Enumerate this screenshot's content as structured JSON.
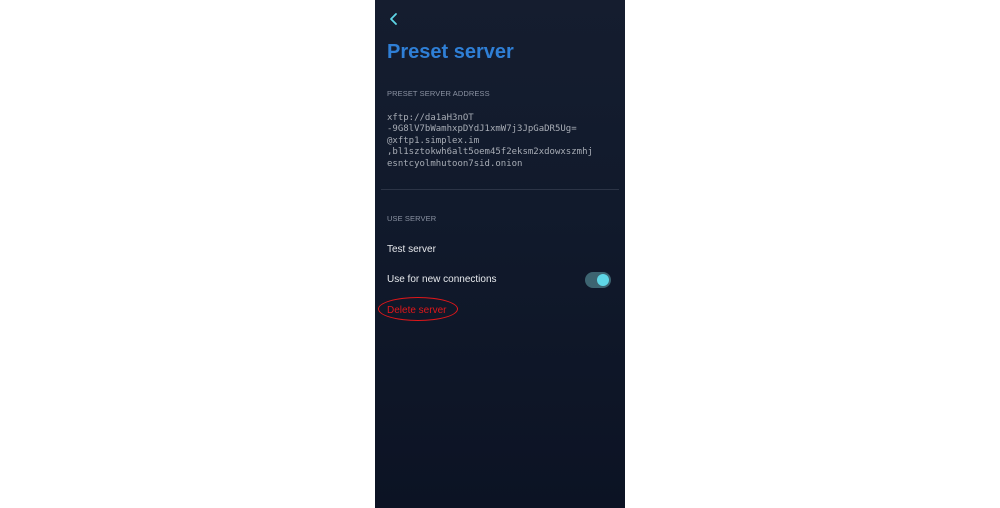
{
  "header": {
    "back_icon": "chevron-left-icon",
    "title": "Preset server"
  },
  "preset_section": {
    "label": "PRESET SERVER ADDRESS",
    "address_lines": [
      "xftp://da1aH3nOT",
      "-9G8lV7bWamhxpDYdJ1xmW7j3JpGaDR5Ug=",
      "@xftp1.simplex.im",
      ",bl1sztokwh6alt5oem45f2eksm2xdowxszmhj",
      "esntcyolmhutoon7sid.onion"
    ]
  },
  "use_section": {
    "label": "USE SERVER",
    "test_server": "Test server",
    "use_for_new_connections": "Use for new connections",
    "use_for_new_connections_enabled": true,
    "delete_server": "Delete server"
  },
  "colors": {
    "title": "#2f7fd6",
    "background": "#121a2c",
    "toggle_knob": "#5ed6e6",
    "delete": "#e0171a"
  }
}
